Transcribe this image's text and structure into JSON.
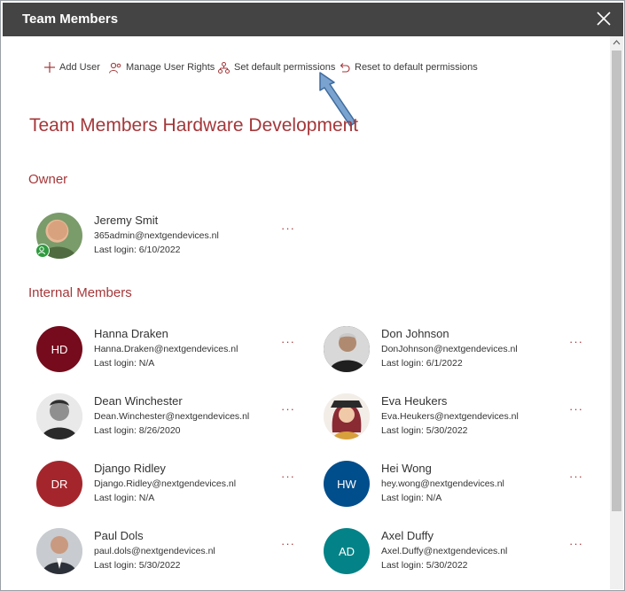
{
  "window": {
    "title": "Team Members"
  },
  "toolbar": {
    "add_user": "Add User",
    "manage_rights": "Manage User Rights",
    "set_default": "Set default permissions",
    "reset_default": "Reset to default permissions"
  },
  "heading": "Team Members Hardware Development",
  "owner_section": {
    "label": "Owner"
  },
  "owner": {
    "name": "Jeremy Smit",
    "email": "365admin@nextgendevices.nl",
    "login": "Last login: 6/10/2022"
  },
  "internal_section": {
    "label": "Internal Members"
  },
  "members": [
    {
      "name": "Hanna Draken",
      "email": "Hanna.Draken@nextgendevices.nl",
      "login": "Last login: N/A",
      "initials": "HD",
      "color": "#750b1c"
    },
    {
      "name": "Don Johnson",
      "email": "DonJohnson@nextgendevices.nl",
      "login": "Last login: 6/1/2022",
      "initials": "",
      "color": "#3a3a3a"
    },
    {
      "name": "Dean Winchester",
      "email": "Dean.Winchester@nextgendevices.nl",
      "login": "Last login: 8/26/2020",
      "initials": "",
      "color": "#555555"
    },
    {
      "name": "Eva Heukers",
      "email": "Eva.Heukers@nextgendevices.nl",
      "login": "Last login: 5/30/2022",
      "initials": "",
      "color": "#8a2a33"
    },
    {
      "name": "Django Ridley",
      "email": "Django.Ridley@nextgendevices.nl",
      "login": "Last login: N/A",
      "initials": "DR",
      "color": "#a4262c"
    },
    {
      "name": "Hei Wong",
      "email": "hey.wong@nextgendevices.nl",
      "login": "Last login: N/A",
      "initials": "HW",
      "color": "#004e8c"
    },
    {
      "name": "Paul Dols",
      "email": "paul.dols@nextgendevices.nl",
      "login": "Last login: 5/30/2022",
      "initials": "",
      "color": "#6b6b6b"
    },
    {
      "name": "Axel Duffy",
      "email": "Axel.Duffy@nextgendevices.nl",
      "login": "Last login: 5/30/2022",
      "initials": "AD",
      "color": "#038387"
    }
  ],
  "more_label": "···",
  "colors": {
    "accent": "#a4373a",
    "titlebar": "#444444",
    "presence": "#2e9b3e"
  }
}
